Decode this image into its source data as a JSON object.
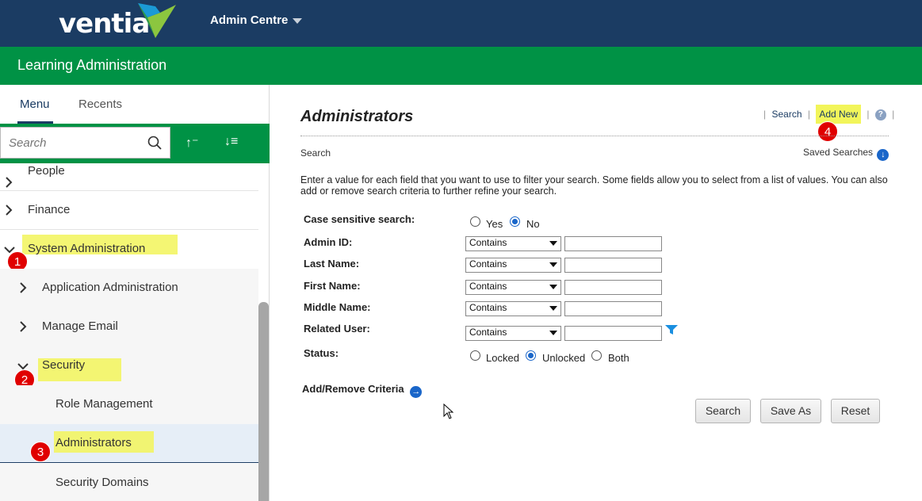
{
  "header": {
    "logo_text": "ventia",
    "app_menu_label": "Admin Centre"
  },
  "section_bar": {
    "title": "Learning Administration"
  },
  "sidebar": {
    "tabs": [
      {
        "label": "Menu",
        "active": true
      },
      {
        "label": "Recents",
        "active": false
      }
    ],
    "search": {
      "placeholder": "Search",
      "value": ""
    },
    "sort_up_glyph": "↑⁻",
    "sort_list_glyph": "↓≡",
    "items": [
      {
        "label": "People",
        "level": 0,
        "expanded": false
      },
      {
        "label": "Finance",
        "level": 0,
        "expanded": false
      },
      {
        "label": "System Administration",
        "level": 0,
        "expanded": true
      },
      {
        "label": "Application Administration",
        "level": 1,
        "expanded": false
      },
      {
        "label": "Manage Email",
        "level": 1,
        "expanded": false
      },
      {
        "label": "Security",
        "level": 1,
        "expanded": true
      },
      {
        "label": "Role Management",
        "level": 2
      },
      {
        "label": "Administrators",
        "level": 2,
        "selected": true
      },
      {
        "label": "Security Domains",
        "level": 2
      }
    ],
    "badges": [
      "1",
      "2",
      "3"
    ]
  },
  "main": {
    "title": "Administrators",
    "links": {
      "search": "Search",
      "add_new": "Add New",
      "help": "?",
      "pipe": "|"
    },
    "add_new_badge": "4",
    "search_heading": "Search",
    "saved_searches": "Saved Searches",
    "intro": "Enter a value for each field that you want to use to filter your search. Some fields allow you to select from a list of values. You can also add or remove search criteria to further refine your search.",
    "case_sensitive": {
      "label": "Case sensitive search:",
      "options": [
        "Yes",
        "No"
      ],
      "selected": "No"
    },
    "fields": [
      {
        "label": "Admin ID:",
        "operator": "Contains",
        "value": ""
      },
      {
        "label": "Last Name:",
        "operator": "Contains",
        "value": ""
      },
      {
        "label": "First Name:",
        "operator": "Contains",
        "value": ""
      },
      {
        "label": "Middle Name:",
        "operator": "Contains",
        "value": ""
      },
      {
        "label": "Related User:",
        "operator": "Contains",
        "value": ""
      }
    ],
    "status": {
      "label": "Status:",
      "options": [
        "Locked",
        "Unlocked",
        "Both"
      ],
      "selected": "Unlocked"
    },
    "add_remove_criteria": "Add/Remove Criteria",
    "buttons": {
      "search": "Search",
      "save_as": "Save As",
      "reset": "Reset"
    }
  },
  "colors": {
    "navy": "#1b3c63",
    "green": "#009245",
    "highlight": "#f2f55a",
    "badge_red": "#e00000",
    "link_blue": "#1a66c9"
  }
}
